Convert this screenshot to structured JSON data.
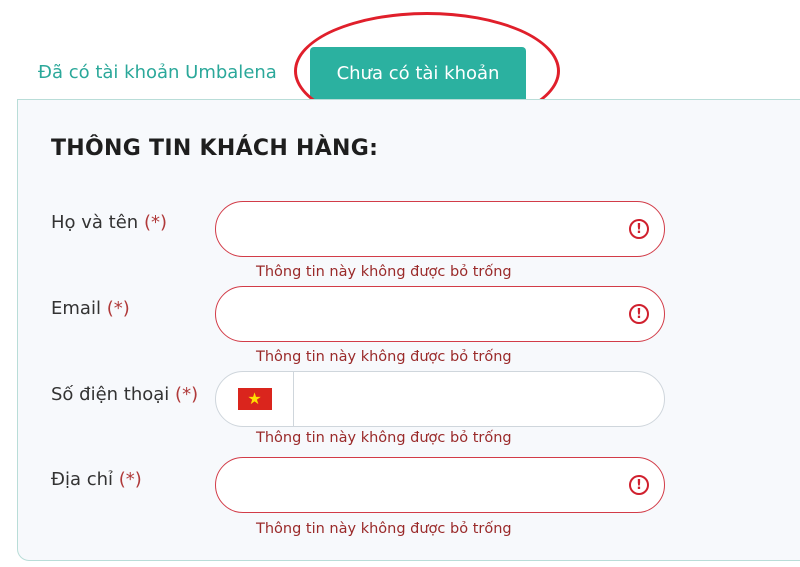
{
  "tabs": {
    "existing_account": "Đã có tài khoản Umbalena",
    "no_account": "Chưa có tài khoản"
  },
  "form": {
    "title": "THÔNG TIN KHÁCH HÀNG:",
    "required_mark": "(*)",
    "fields": [
      {
        "label": "Họ và tên",
        "value": "",
        "error": "Thông tin này không được bỏ trống"
      },
      {
        "label": "Email",
        "value": "",
        "error": "Thông tin này không được bỏ trống"
      },
      {
        "label": "Số điện thoại",
        "value": "",
        "country": "Vietnam",
        "error": "Thông tin này không được bỏ trống"
      },
      {
        "label": "Địa chỉ",
        "value": "",
        "error": "Thông tin này không được bỏ trống"
      }
    ]
  },
  "icons": {
    "alert": "alert-circle-icon",
    "flag": "vietnam-flag-icon"
  },
  "colors": {
    "accent": "#2bb1a0",
    "error": "#d23c48",
    "highlight": "#e01f2b"
  }
}
